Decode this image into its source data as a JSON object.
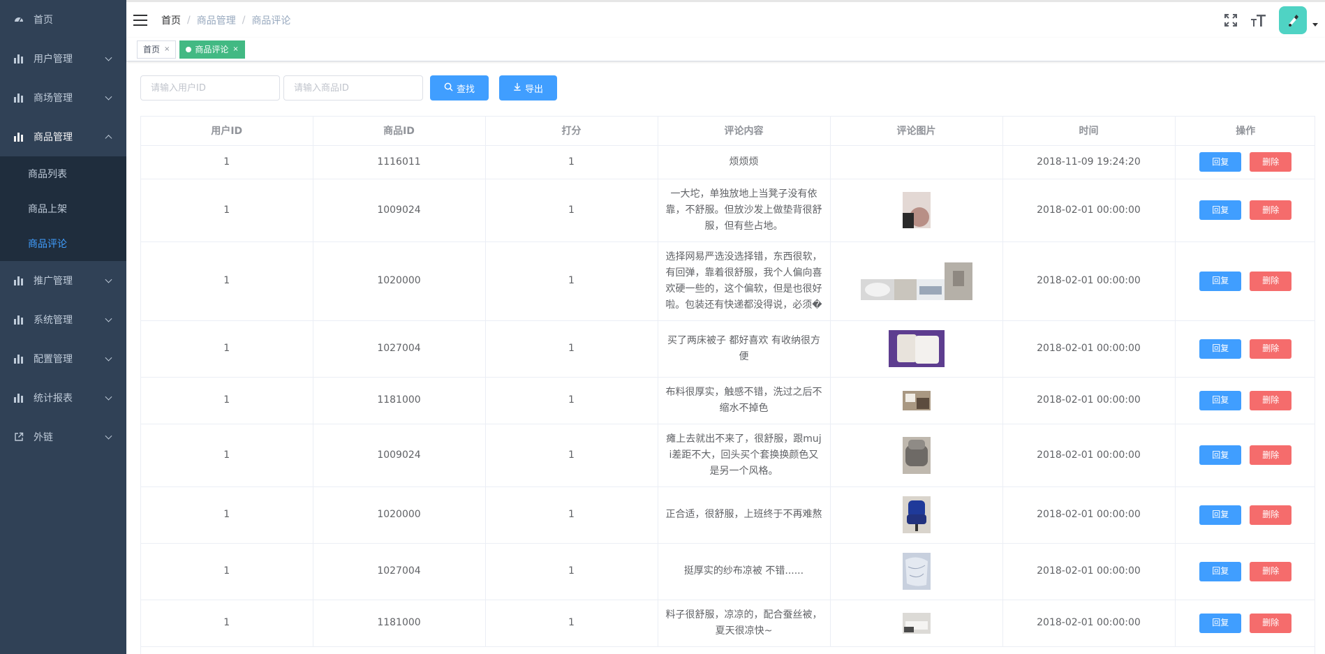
{
  "sidebar": {
    "items": [
      {
        "label": "首页"
      },
      {
        "label": "用户管理"
      },
      {
        "label": "商场管理"
      },
      {
        "label": "商品管理"
      },
      {
        "label": "推广管理"
      },
      {
        "label": "系统管理"
      },
      {
        "label": "配置管理"
      },
      {
        "label": "统计报表"
      },
      {
        "label": "外链"
      }
    ],
    "sub_items": [
      {
        "label": "商品列表"
      },
      {
        "label": "商品上架"
      },
      {
        "label": "商品评论"
      }
    ]
  },
  "breadcrumb": {
    "home": "首页",
    "parent": "商品管理",
    "current": "商品评论"
  },
  "tags": {
    "home": "首页",
    "current": "商品评论"
  },
  "filter": {
    "user_placeholder": "请输入用户ID",
    "goods_placeholder": "请输入商品ID",
    "search_label": "查找",
    "export_label": "导出"
  },
  "table": {
    "headers": [
      "用户ID",
      "商品ID",
      "打分",
      "评论内容",
      "评论图片",
      "时间",
      "操作"
    ],
    "reply_label": "回复",
    "delete_label": "删除",
    "rows": [
      {
        "user_id": "1",
        "goods_id": "1116011",
        "score": "1",
        "content": "烦烦烦",
        "time": "2018-11-09 19:24:20"
      },
      {
        "user_id": "1",
        "goods_id": "1009024",
        "score": "1",
        "content": "一大坨，单独放地上当凳子没有依靠，不舒服。但放沙发上做垫背很舒服，但有些占地。",
        "time": "2018-02-01 00:00:00"
      },
      {
        "user_id": "1",
        "goods_id": "1020000",
        "score": "1",
        "content": "选择网易严选没选择错，东西很软，有回弹，靠着很舒服，我个人偏向喜欢硬一些的，这个偏软，但是也很好啦。包装还有快递都没得说，必须�",
        "time": "2018-02-01 00:00:00"
      },
      {
        "user_id": "1",
        "goods_id": "1027004",
        "score": "1",
        "content": "买了两床被子 都好喜欢 有收纳很方便",
        "time": "2018-02-01 00:00:00"
      },
      {
        "user_id": "1",
        "goods_id": "1181000",
        "score": "1",
        "content": "布料很厚实，触感不错，洗过之后不缩水不掉色",
        "time": "2018-02-01 00:00:00"
      },
      {
        "user_id": "1",
        "goods_id": "1009024",
        "score": "1",
        "content": "瘫上去就出不来了，很舒服，跟muji差距不大，回头买个套换换颜色又是另一个风格。",
        "time": "2018-02-01 00:00:00"
      },
      {
        "user_id": "1",
        "goods_id": "1020000",
        "score": "1",
        "content": "正合适，很舒服，上班终于不再难熬",
        "time": "2018-02-01 00:00:00"
      },
      {
        "user_id": "1",
        "goods_id": "1027004",
        "score": "1",
        "content": "挺厚实的纱布凉被 不错......",
        "time": "2018-02-01 00:00:00"
      },
      {
        "user_id": "1",
        "goods_id": "1181000",
        "score": "1",
        "content": "料子很舒服，凉凉的，配合蚕丝被，夏天很凉快~",
        "time": "2018-02-01 00:00:00"
      }
    ]
  },
  "colors": {
    "sidebar_bg": "#304156",
    "primary": "#409eff",
    "danger": "#f56c6c",
    "tag_active": "#42b983",
    "active_menu": "#409eff"
  }
}
